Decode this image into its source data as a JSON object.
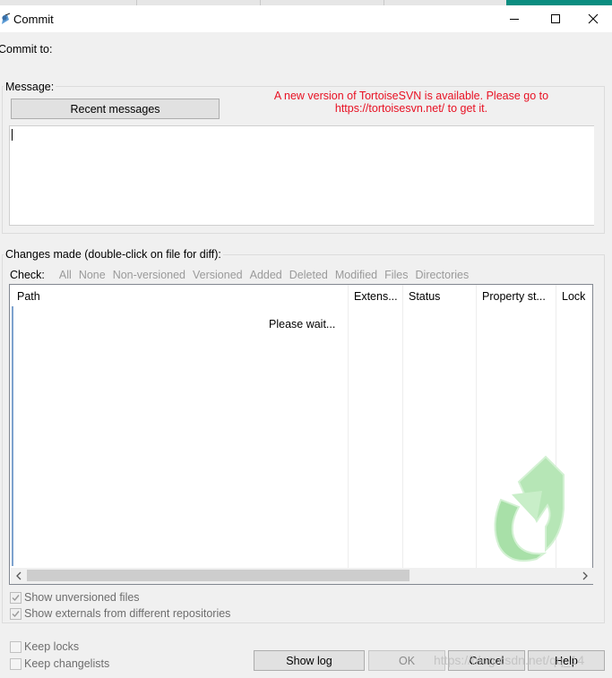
{
  "window": {
    "title": "Commit",
    "minimize_icon": "minimize-icon",
    "maximize_icon": "maximize-icon",
    "close_icon": "close-icon"
  },
  "commit_to": {
    "label": "Commit to:"
  },
  "message": {
    "group_label": "Message:",
    "recent_messages_button": "Recent messages",
    "update_notice_line1": "A new version of TortoiseSVN is available. Please go to",
    "update_notice_line2": "https://tortoisesvn.net/ to get it.",
    "text": "",
    "notice_color": "#e81123"
  },
  "changes": {
    "group_label": "Changes made (double-click on file for diff):",
    "check_label": "Check:",
    "filters": [
      "All",
      "None",
      "Non-versioned",
      "Versioned",
      "Added",
      "Deleted",
      "Modified",
      "Files",
      "Directories"
    ],
    "columns": [
      "Path",
      "Extens...",
      "Status",
      "Property st...",
      "Lock"
    ],
    "loading_text": "Please wait..."
  },
  "options": {
    "show_unversioned": {
      "label": "Show unversioned files",
      "checked": true,
      "enabled": false
    },
    "show_externals": {
      "label": "Show externals from different repositories",
      "checked": true,
      "enabled": false
    },
    "keep_locks": {
      "label": "Keep locks",
      "checked": false,
      "enabled": false
    },
    "keep_changelists": {
      "label": "Keep changelists",
      "checked": false,
      "enabled": false
    }
  },
  "buttons": {
    "show_log": "Show log",
    "ok": "OK",
    "cancel": "Cancel",
    "help": "Help"
  },
  "watermark": "https://blog.csdn.net/qq_14",
  "icons": {
    "app": "tortoisesvn-app-icon",
    "busy": "busy-arrow-icon",
    "scroll_left": "scroll-left-icon",
    "scroll_right": "scroll-right-icon"
  }
}
